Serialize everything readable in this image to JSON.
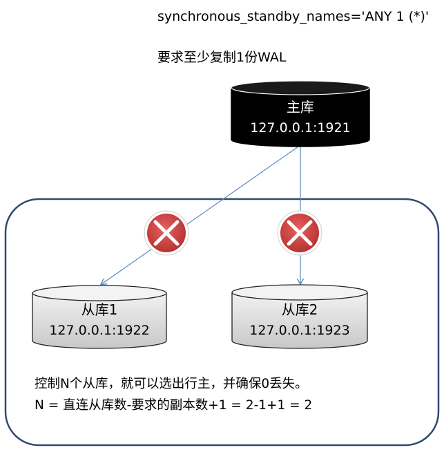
{
  "header": {
    "config_line": "synchronous_standby_names='ANY 1 (*)'",
    "requirement": "要求至少复制1份WAL"
  },
  "primary": {
    "name": "主库",
    "address": "127.0.0.1:1921"
  },
  "standbys": [
    {
      "name": "从库1",
      "address": "127.0.0.1:1922"
    },
    {
      "name": "从库2",
      "address": "127.0.0.1:1923"
    }
  ],
  "notes": {
    "line1": "控制N个从库，就可以选出行主，并确保0丢失。",
    "line2": "N = 直连从库数-要求的副本数+1 = 2-1+1 = 2"
  },
  "colors": {
    "primary_fill": "#000000",
    "standby_fill": "#e6e6e6",
    "link_line": "#5b87c0",
    "fail_marker": "#d24343"
  }
}
